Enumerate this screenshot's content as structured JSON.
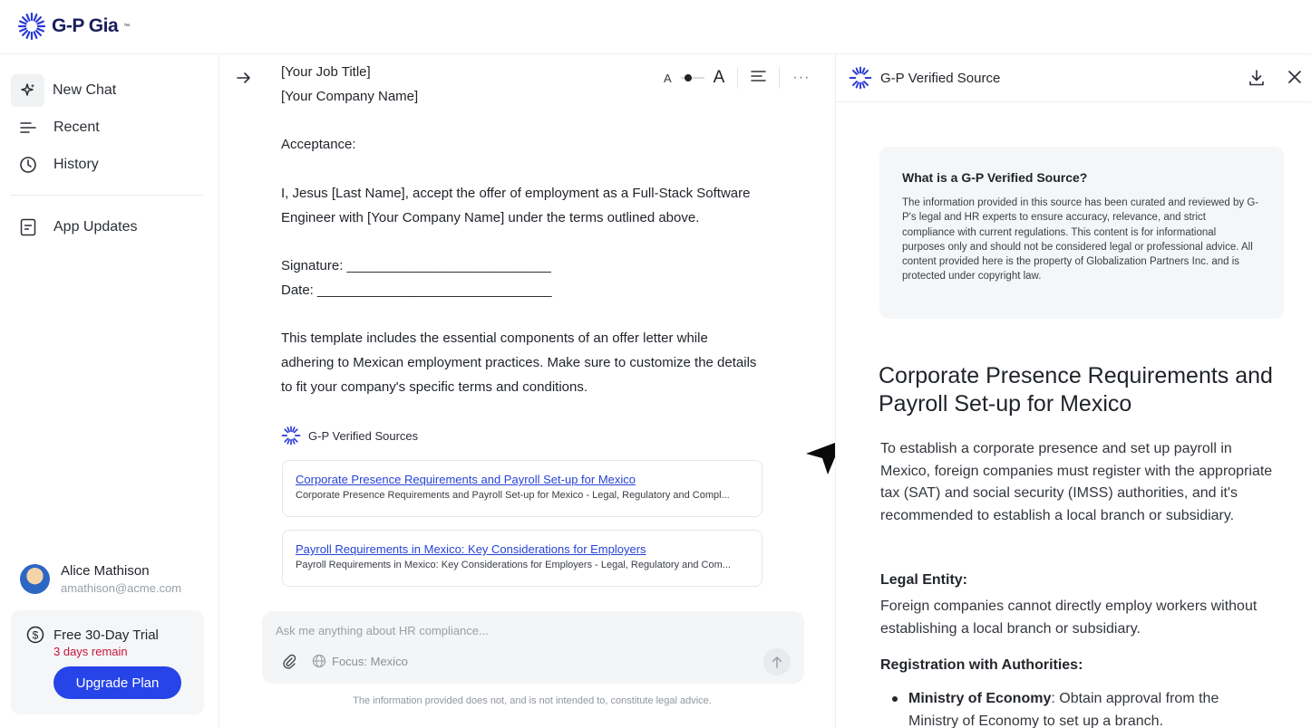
{
  "brand": {
    "name": "G-P Gia",
    "tm": "™"
  },
  "sidebar": {
    "items": [
      {
        "label": "New Chat",
        "icon": "sparkle-icon"
      },
      {
        "label": "Recent",
        "icon": "list-icon"
      },
      {
        "label": "History",
        "icon": "clock-icon"
      },
      {
        "label": "App Updates",
        "icon": "document-icon"
      }
    ],
    "user": {
      "name": "Alice Mathison",
      "email": "amathison@acme.com"
    },
    "trial": {
      "title": "Free 30-Day Trial",
      "remaining": "3 days remain",
      "upgrade_label": "Upgrade Plan"
    }
  },
  "toolbar": {
    "font_small": "A",
    "font_large": "A",
    "more": "···"
  },
  "message": {
    "lines_a": [
      "[Your Job Title]",
      "[Your Company Name]"
    ],
    "acceptance": "Acceptance:",
    "acceptance_text": "I, Jesus [Last Name], accept the offer of employment as a Full-Stack Software Engineer with [Your Company Name] under the terms outlined above.",
    "signature": "Signature: ___________________________",
    "date": "Date: _______________________________",
    "summary": "This template includes the essential components of an offer letter while adhering to Mexican employment practices. Make sure to customize the details to fit your company's specific terms and conditions."
  },
  "sources": {
    "label_prefix": "G-P Verified",
    "label_suffix": " Sources",
    "items": [
      {
        "title": "Corporate Presence Requirements and Payroll Set-up for Mexico",
        "description": "Corporate Presence Requirements and Payroll Set-up for Mexico - Legal, Regulatory and Compl..."
      },
      {
        "title": "Payroll Requirements in Mexico: Key Considerations for Employers",
        "description": "Payroll Requirements in Mexico: Key Considerations for Employers - Legal, Regulatory and Com..."
      }
    ]
  },
  "composer": {
    "placeholder": "Ask me anything about HR compliance...",
    "focus_label": "Focus: Mexico",
    "disclaimer": "The information provided does not, and is not intended to, constitute legal advice."
  },
  "panel": {
    "title": "G-P Verified Source",
    "info_title": "What is a G-P Verified Source?",
    "info_body": "The information provided in this source has been curated and reviewed by G-P's legal and HR experts to ensure accuracy, relevance, and strict compliance with current regulations. This content is for informational purposes only and should not be considered legal or professional advice. All content provided here is the property of Globalization Partners Inc. and is protected under copyright law.",
    "doc_title": "Corporate Presence Requirements and Payroll Set-up for Mexico",
    "intro": "To establish a corporate presence and set up payroll in Mexico, foreign companies must register with the appropriate tax (SAT) and social security (IMSS) authorities, and it's recommended to establish a local branch or subsidiary.",
    "h_legal": "Legal Entity:",
    "legal_text": "Foreign companies cannot directly employ workers without establishing a local branch or subsidiary.",
    "h_registration": "Registration with Authorities:",
    "bullet_bold": "Ministry of Economy",
    "bullet_text": ": Obtain approval from the Ministry of Economy to set up a branch."
  },
  "colors": {
    "accent": "#2744e8",
    "warning": "#c4163a",
    "link": "#2843d6",
    "brand": "#1a1f5c"
  }
}
